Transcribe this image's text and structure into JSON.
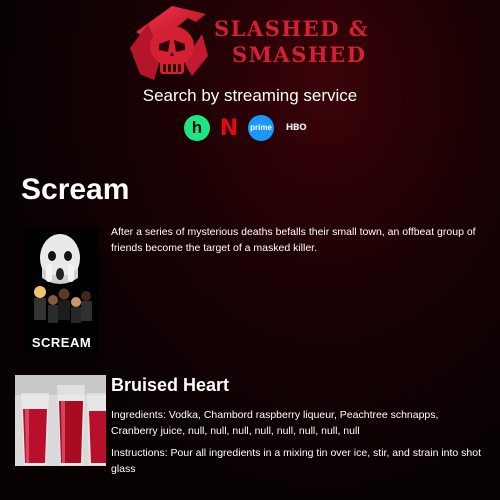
{
  "header": {
    "logo_line1": "SLASHED &",
    "logo_line2": "SMASHED",
    "search_label": "Search by streaming service",
    "services": [
      {
        "name": "Hulu",
        "glyph": "h",
        "icon": "hulu-icon",
        "color": "#1ce783"
      },
      {
        "name": "Netflix",
        "glyph": "N",
        "icon": "netflix-icon",
        "color": "#e50914"
      },
      {
        "name": "Prime Video",
        "glyph": "prime",
        "icon": "prime-video-icon",
        "color": "#1a98ff"
      },
      {
        "name": "HBO",
        "glyph": "HBO",
        "icon": "hbo-icon",
        "color": "#e8e8e8"
      }
    ]
  },
  "movie": {
    "title": "Scream",
    "poster_title": "SCREAM",
    "synopsis": "After a series of mysterious deaths befalls their small town, an offbeat group of friends become the target of a masked killer."
  },
  "drink": {
    "name": "Bruised Heart",
    "ingredients": "Ingredients: Vodka, Chambord raspberry liqueur, Peachtree schnapps, Cranberry juice, null, null, null, null, null, null, null, null",
    "instructions": "Instructions: Pour all ingredients in a mixing tin over ice, stir, and strain into shot glass"
  },
  "colors": {
    "accent": "#d42032",
    "background": "#0a0203"
  }
}
